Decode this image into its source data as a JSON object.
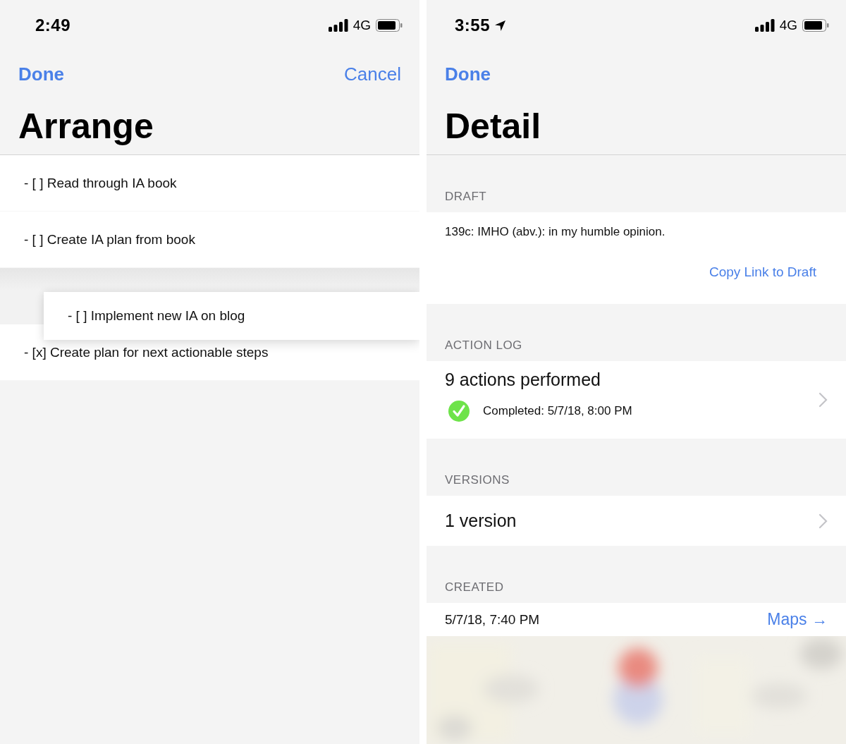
{
  "arrange": {
    "status_bar": {
      "time": "2:49",
      "network": "4G"
    },
    "nav": {
      "done": "Done",
      "cancel": "Cancel"
    },
    "title": "Arrange",
    "items": [
      {
        "kind": "row",
        "text": "- [ ] Read through IA book"
      },
      {
        "kind": "row",
        "text": "- [ ] Create IA plan from book"
      },
      {
        "kind": "dragged",
        "text": "- [ ] Implement new IA on blog"
      },
      {
        "kind": "row",
        "text": "- [x] Create plan for next actionable steps"
      }
    ]
  },
  "detail": {
    "status_bar": {
      "time": "3:55",
      "network": "4G",
      "location": true
    },
    "nav": {
      "done": "Done"
    },
    "title": "Detail",
    "sections": [
      {
        "kind": "draft",
        "header": "DRAFT",
        "text": "139c: IMHO (abv.): in my humble opinion.",
        "link": "Copy Link to Draft"
      },
      {
        "kind": "log",
        "header": "ACTION LOG",
        "title": "9 actions performed",
        "status": "Completed: 5/7/18, 8:00 PM",
        "completed": true
      },
      {
        "kind": "versions",
        "header": "VERSIONS",
        "title": "1 version"
      },
      {
        "kind": "created",
        "header": "CREATED",
        "text": "5/7/18, 7:40 PM",
        "link": "Maps →"
      }
    ]
  }
}
